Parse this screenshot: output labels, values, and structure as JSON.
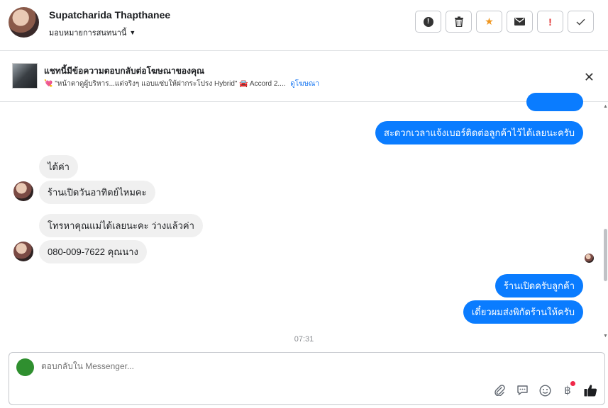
{
  "header": {
    "contact_name": "Supatcharida Thapthanee",
    "assign_label": "มอบหมายการสนทนานี้",
    "actions": [
      {
        "name": "mark-spam-button",
        "icon": "alert-circle-icon"
      },
      {
        "name": "delete-button",
        "icon": "trash-icon"
      },
      {
        "name": "star-button",
        "icon": "star-icon"
      },
      {
        "name": "mark-unread-button",
        "icon": "envelope-icon"
      },
      {
        "name": "follow-up-button",
        "icon": "exclamation-icon"
      },
      {
        "name": "mark-done-button",
        "icon": "check-icon"
      }
    ]
  },
  "ad_banner": {
    "title": "แชทนี้มีข้อความตอบกลับต่อโฆษณาของคุณ",
    "snippet_text": "\"หน้าตาดูผู้บริหาร...แต่จริงๆ แอบแซ่บให้ฝากระโปรง Hybrid\"",
    "snippet_model": "Accord 2....",
    "view_ad_link": "ดูโฆษณา"
  },
  "messages": [
    {
      "dir": "out",
      "text": ""
    },
    {
      "dir": "out",
      "text": "สะดวกเวลาแจ้งเบอร์ติดต่อลูกค้าไว้ได้เลยนะครับ"
    },
    {
      "dir": "in",
      "text": "ได้ค่า"
    },
    {
      "dir": "in",
      "text": "ร้านเปิดวันอาทิตย์ไหมคะ"
    },
    {
      "dir": "in",
      "text": "โทรหาคุณแม่ได้เลยนะคะ ว่างแล้วค่า"
    },
    {
      "dir": "in",
      "text": "080-009-7622 คุณนาง"
    },
    {
      "dir": "out",
      "text": "ร้านเปิดครับลูกค้า"
    },
    {
      "dir": "out",
      "text": "เดี๋ยวผมส่งพิกัดร้านให้ครับ"
    }
  ],
  "timestamp": "07:31",
  "composer": {
    "placeholder": "ตอบกลับใน Messenger...",
    "tools": [
      "paperclip-icon",
      "saved-replies-icon",
      "emoji-icon",
      "baht-payment-icon",
      "thumbs-up-icon"
    ]
  },
  "colors": {
    "outgoing_bubble": "#0a7cff",
    "incoming_bubble": "#f0f0f0",
    "star_accent": "#f0961f",
    "follow_up_red": "#e03131",
    "link_blue": "#1877f2"
  }
}
